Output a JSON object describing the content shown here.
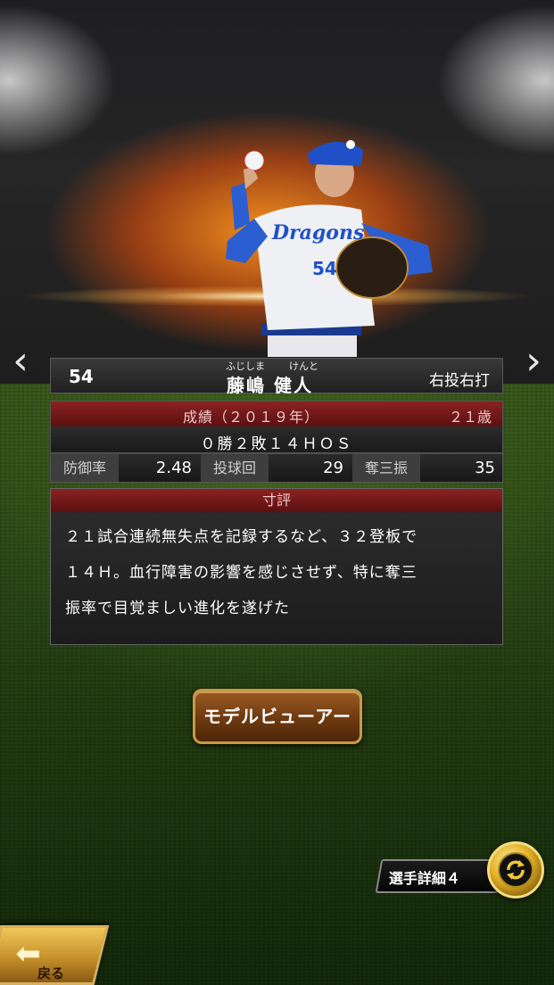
{
  "player": {
    "number": "54",
    "ruby_family": "ふじしま",
    "ruby_given": "けんと",
    "name": "藤嶋 健人",
    "throw_bat": "右投右打",
    "jersey_logo": "Dragons",
    "jersey_number": "54"
  },
  "stats": {
    "title": "成績（２０１９年）",
    "age": "２１歳",
    "record": "０勝２敗１４ＨＯＳ",
    "items": [
      {
        "label": "防御率",
        "value": "2.48"
      },
      {
        "label": "投球回",
        "value": "29"
      },
      {
        "label": "奪三振",
        "value": "35"
      }
    ]
  },
  "comment": {
    "title": "寸評",
    "lines": [
      "２１試合連続無失点を記録するなど、３２登板で",
      "１４Ｈ。血行障害の影響を感じさせず、特に奪三",
      "振率で目覚ましい進化を遂げた"
    ]
  },
  "buttons": {
    "model_viewer": "モデルビューアー",
    "detail_tab": "選手詳細４",
    "back": "戻る"
  },
  "icons": {
    "prev": "chevron-left-icon",
    "next": "chevron-right-icon",
    "switch": "rotate-arrows-icon",
    "back": "arrow-left-icon"
  },
  "colors": {
    "header_red": "#8a2222",
    "button_brown": "#6e3a10",
    "gold": "#e2b028"
  }
}
